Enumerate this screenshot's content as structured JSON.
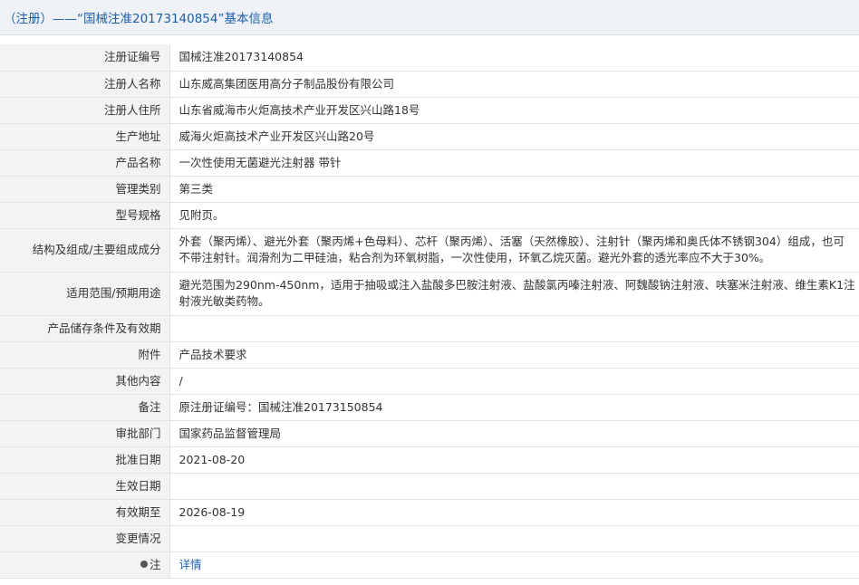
{
  "header": {
    "title": "（注册）——“国械注准20173140854”基本信息"
  },
  "rows": [
    {
      "label": "注册证编号",
      "value": "国械注准20173140854"
    },
    {
      "label": "注册人名称",
      "value": "山东威高集团医用高分子制品股份有限公司"
    },
    {
      "label": "注册人住所",
      "value": "山东省威海市火炬高技术产业开发区兴山路18号"
    },
    {
      "label": "生产地址",
      "value": "威海火炬高技术产业开发区兴山路20号"
    },
    {
      "label": "产品名称",
      "value": "一次性使用无菌避光注射器 带针"
    },
    {
      "label": "管理类别",
      "value": "第三类"
    },
    {
      "label": "型号规格",
      "value": "见附页。"
    },
    {
      "label": "结构及组成/主要组成成分",
      "value": "外套（聚丙烯）、避光外套（聚丙烯+色母料）、芯杆（聚丙烯）、活塞（天然橡胶）、注射针（聚丙烯和奥氏体不锈钢304）组成，也可不带注射针。润滑剂为二甲硅油，粘合剂为环氧树脂，一次性使用，环氧乙烷灭菌。避光外套的透光率应不大于30%。"
    },
    {
      "label": "适用范围/预期用途",
      "value": "避光范围为290nm-450nm，适用于抽吸或注入盐酸多巴胺注射液、盐酸氯丙嗪注射液、阿魏酸钠注射液、呋塞米注射液、维生素K1注射液光敏类药物。"
    },
    {
      "label": "产品储存条件及有效期",
      "value": ""
    },
    {
      "label": "附件",
      "value": "产品技术要求"
    },
    {
      "label": "其他内容",
      "value": "/"
    },
    {
      "label": "备注",
      "value": "原注册证编号：国械注准20173150854"
    },
    {
      "label": "审批部门",
      "value": "国家药品监督管理局"
    },
    {
      "label": "批准日期",
      "value": "2021-08-20"
    },
    {
      "label": "生效日期",
      "value": ""
    },
    {
      "label": "有效期至",
      "value": "2026-08-19"
    },
    {
      "label": "变更情况",
      "value": ""
    },
    {
      "label": "注",
      "value": "详情"
    }
  ]
}
